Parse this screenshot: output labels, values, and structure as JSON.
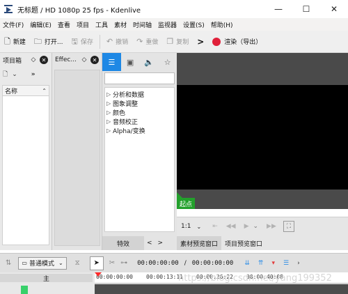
{
  "window": {
    "title": "无标题 / HD 1080p 25 fps - Kdenlive",
    "controls": {
      "minimize": "—",
      "maximize": "☐",
      "close": "✕"
    }
  },
  "menu": {
    "items": [
      "文件(F)",
      "编辑(E)",
      "查看",
      "项目",
      "工具",
      "素材",
      "时间轴",
      "监视器",
      "设置(S)",
      "帮助(H)"
    ]
  },
  "toolbar": {
    "new_label": "新建",
    "open_label": "打开...",
    "save_label": "保存",
    "undo_label": "撤销",
    "redo_label": "重做",
    "copy_label": "复制",
    "more_label": ">",
    "render_label": "渲染（导出）"
  },
  "project_bin": {
    "header": "项目箱",
    "column_name": "名称",
    "more_label": "»"
  },
  "effect_stack": {
    "header": "Effec..."
  },
  "effects_list": {
    "categories": [
      "分析和数据",
      "图象调整",
      "颜色",
      "音频校正",
      "Alpha/变换"
    ],
    "tabs": [
      "特效",
      "<",
      ">"
    ]
  },
  "monitor": {
    "zone_label": "起点",
    "zoom": "1:1",
    "tabs": [
      "素材预览窗口",
      "项目预览窗口"
    ]
  },
  "timeline": {
    "mode": "普通模式",
    "position": "00:00:00:00",
    "separator": "/",
    "duration": "00:00:00:00",
    "track_label": "主",
    "ruler_ticks": [
      "00:00:00:00",
      "00:00:13:11",
      "00:00:26:22",
      "00:00:40:08"
    ]
  },
  "watermark": "https://blog.csdn.net/yang199352"
}
